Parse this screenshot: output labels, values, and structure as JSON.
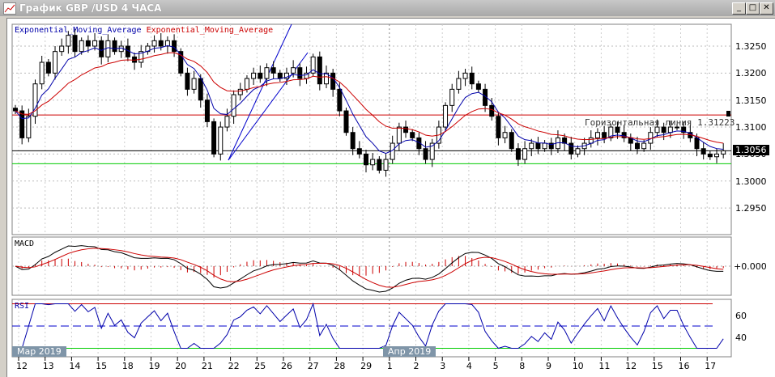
{
  "window": {
    "title": "График GBP /USD  4 ЧАСА",
    "buttons": {
      "minimize": "_",
      "maximize": "□",
      "close": "✕"
    }
  },
  "main_pane": {
    "legend": [
      {
        "label": "Exponential_Moving_Average",
        "color": "#0000aa"
      },
      {
        "label": "Exponential_Moving_Average",
        "color": "#cc0000"
      }
    ],
    "price_labels": [
      "1.3250",
      "1.3200",
      "1.3150",
      "1.3100",
      "1.3050",
      "1.3000",
      "1.2950"
    ],
    "current_price": "1.3056",
    "hline_label": "Горизонтальная линия 1.31223"
  },
  "macd_pane": {
    "label": "MACD",
    "zero_label": "+0.000"
  },
  "rsi_pane": {
    "label": "RSI",
    "levels_labels": [
      "60",
      "40"
    ]
  },
  "time_axis": {
    "dates": [
      "12",
      "13",
      "14",
      "15",
      "18",
      "19",
      "20",
      "21",
      "22",
      "25",
      "26",
      "27",
      "28",
      "29",
      "1",
      "2",
      "3",
      "4",
      "5",
      "8",
      "9",
      "10",
      "11",
      "12",
      "15",
      "16",
      "17"
    ],
    "months": [
      "Мар 2019",
      "Апр 2019"
    ]
  },
  "chart_data": {
    "type": "candlestick",
    "symbol": "GBP/USD",
    "timeframe": "4 ЧАСА",
    "ylim": [
      1.2925,
      1.329
    ],
    "closes": [
      1.313,
      1.308,
      1.312,
      1.318,
      1.322,
      1.32,
      1.324,
      1.325,
      1.327,
      1.324,
      1.326,
      1.325,
      1.326,
      1.323,
      1.326,
      1.324,
      1.325,
      1.323,
      1.322,
      1.324,
      1.325,
      1.326,
      1.325,
      1.326,
      1.324,
      1.32,
      1.317,
      1.319,
      1.315,
      1.311,
      1.305,
      1.31,
      1.312,
      1.316,
      1.317,
      1.319,
      1.32,
      1.319,
      1.321,
      1.32,
      1.319,
      1.32,
      1.321,
      1.319,
      1.32,
      1.323,
      1.318,
      1.32,
      1.317,
      1.313,
      1.309,
      1.306,
      1.305,
      1.303,
      1.304,
      1.302,
      1.304,
      1.307,
      1.31,
      1.309,
      1.308,
      1.306,
      1.304,
      1.307,
      1.31,
      1.314,
      1.317,
      1.319,
      1.32,
      1.318,
      1.317,
      1.314,
      1.312,
      1.308,
      1.309,
      1.306,
      1.304,
      1.306,
      1.307,
      1.306,
      1.307,
      1.306,
      1.308,
      1.307,
      1.305,
      1.306,
      1.307,
      1.308,
      1.309,
      1.308,
      1.31,
      1.309,
      1.308,
      1.307,
      1.306,
      1.307,
      1.309,
      1.31,
      1.309,
      1.31,
      1.31,
      1.309,
      1.308,
      1.306,
      1.305,
      1.3045,
      1.305,
      1.3056
    ],
    "horizontal_lines": [
      {
        "price": 1.31223,
        "color": "#cc0000"
      },
      {
        "price": 1.3056,
        "color": "#000000"
      },
      {
        "price": 1.3032,
        "color": "#00cc00"
      }
    ],
    "rsi_levels": {
      "upper": 70,
      "middle": 50,
      "lower": 30
    },
    "colors": {
      "ema_fast": "#0000aa",
      "ema_slow": "#cc0000",
      "macd": "#000000",
      "signal": "#cc0000",
      "histogram": "#cc0000",
      "rsi": "#0000aa"
    }
  }
}
